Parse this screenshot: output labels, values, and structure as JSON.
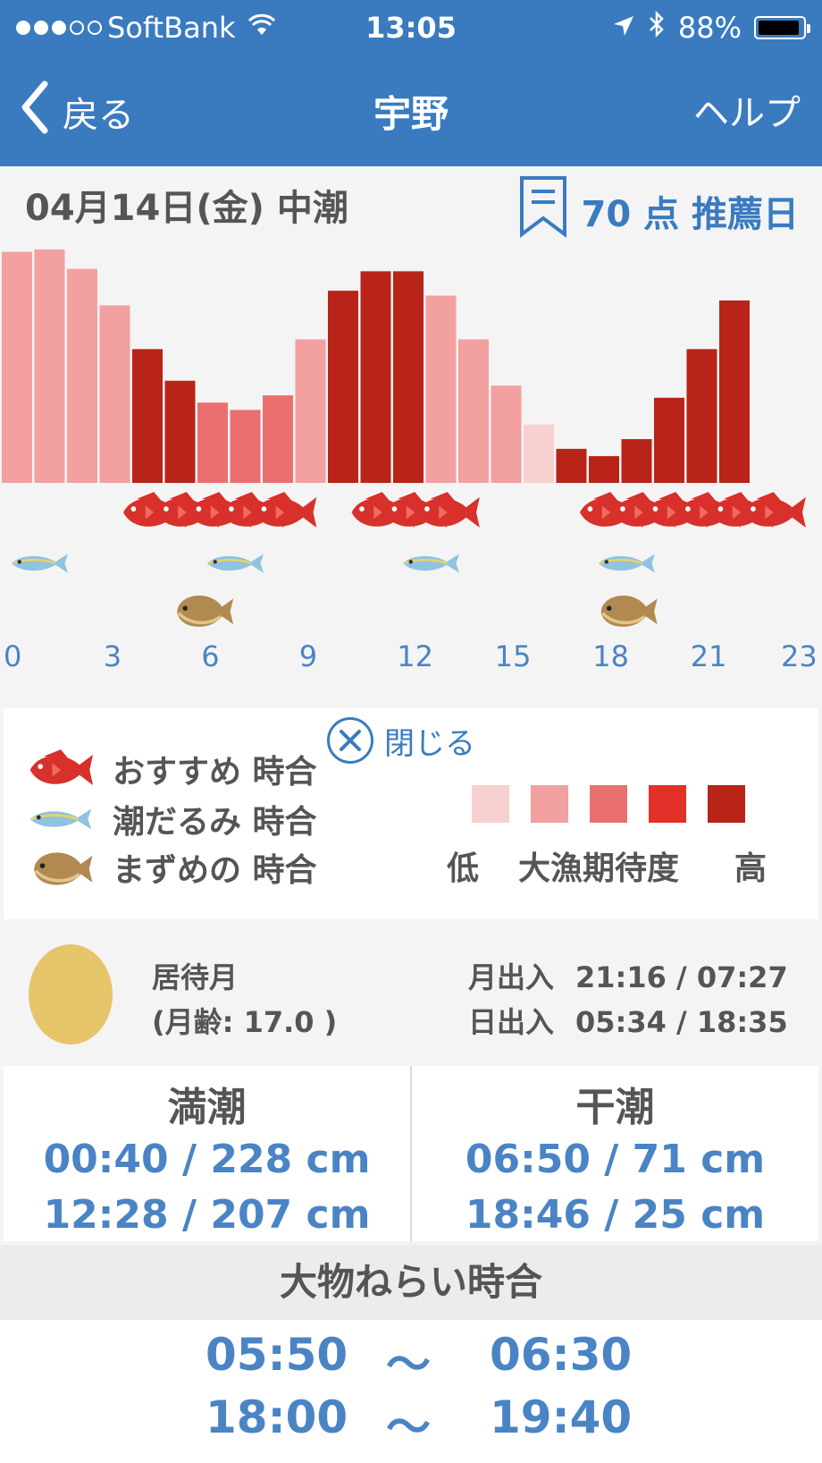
{
  "status_bar": {
    "carrier": "SoftBank",
    "time": "13:05",
    "battery": "88%"
  },
  "nav": {
    "back_label": "戻る",
    "title": "宇野",
    "help_label": "ヘルプ"
  },
  "header": {
    "date_tide": "04月14日(金) 中潮",
    "score_label": "70 点 推薦日"
  },
  "chart_data": {
    "type": "bar",
    "categories": [
      0,
      1,
      2,
      3,
      4,
      5,
      6,
      7,
      8,
      9,
      10,
      11,
      12,
      13,
      14,
      15,
      16,
      17,
      18,
      19,
      20,
      21,
      22,
      23
    ],
    "tick_labels": [
      "0",
      "3",
      "6",
      "9",
      "12",
      "15",
      "18",
      "21",
      "23"
    ],
    "tick_hours": [
      0,
      3,
      6,
      9,
      12,
      15,
      18,
      21,
      23
    ],
    "values": [
      95,
      96,
      88,
      73,
      55,
      42,
      33,
      30,
      36,
      59,
      79,
      87,
      87,
      77,
      59,
      40,
      24,
      14,
      11,
      18,
      35,
      55,
      75
    ],
    "levels": [
      2,
      2,
      2,
      2,
      5,
      5,
      3,
      3,
      3,
      2,
      5,
      5,
      5,
      2,
      2,
      2,
      1,
      5,
      5,
      5,
      5,
      5,
      5
    ],
    "level_colors": {
      "1": "#f8d0d0",
      "2": "#f2a0a0",
      "3": "#ea7070",
      "4": "#e33028",
      "5": "#b82418"
    },
    "ylim": [
      0,
      100
    ],
    "recommended_hours": [
      4,
      5,
      6,
      7,
      8,
      11,
      12,
      13,
      18,
      19,
      20,
      21,
      22,
      23
    ],
    "slack_tide_hours": [
      0.5,
      6.5,
      12.5,
      18.5
    ],
    "dawn_dusk_hours": [
      5.5,
      18.5
    ]
  },
  "legend": {
    "close_label": "閉じる",
    "items": [
      {
        "label": "おすすめ 時合",
        "icon": "red-sea-bream-icon"
      },
      {
        "label": "潮だるみ 時合",
        "icon": "horse-mackerel-icon"
      },
      {
        "label": "まずめの 時合",
        "icon": "flounder-icon"
      }
    ],
    "scale_low": "低",
    "scale_title": "大漁期待度",
    "scale_high": "高",
    "scale_colors": [
      "#f8d0d0",
      "#f2a0a0",
      "#ea7070",
      "#e33028",
      "#b82418"
    ]
  },
  "moon": {
    "phase_name": "居待月",
    "age_text": "(月齢: 17.0 )",
    "moonrise_label": "月出入",
    "moonrise_value": "21:16 / 07:27",
    "sunrise_label": "日出入",
    "sunrise_value": "05:34 / 18:35",
    "color": "#e6c46a"
  },
  "tides": {
    "high_label": "満潮",
    "high": [
      "00:40 / 228 cm",
      "12:28 / 207 cm"
    ],
    "low_label": "干潮",
    "low": [
      "06:50 / 71 cm",
      "18:46 / 25 cm"
    ]
  },
  "big_fish": {
    "title": "大物ねらい時合",
    "tilde": "〜",
    "ranges": [
      {
        "start": "05:50",
        "end": "06:30"
      },
      {
        "start": "18:00",
        "end": "19:40"
      }
    ]
  },
  "colors": {
    "nav_blue": "#3a7bc0",
    "text_blue": "#4a84c4",
    "text_gray": "#555555"
  }
}
